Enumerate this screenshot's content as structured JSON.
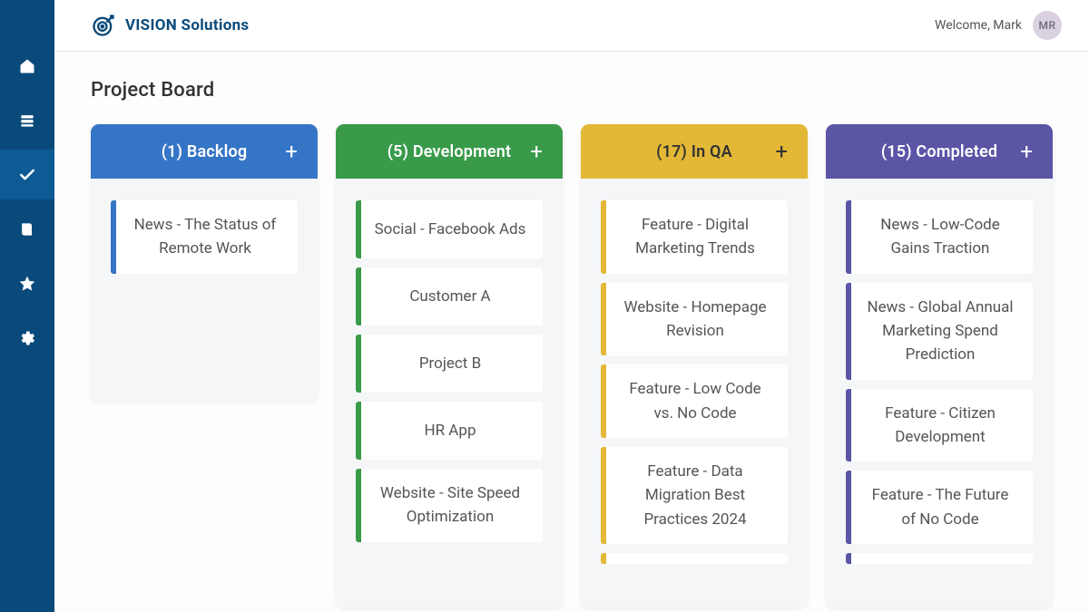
{
  "brand": "VISION Solutions",
  "welcome": "Welcome, Mark",
  "avatar_initials": "MR",
  "page_title": "Project Board",
  "sidebar": {
    "items": [
      {
        "icon": "home"
      },
      {
        "icon": "layers"
      },
      {
        "icon": "check",
        "active": true
      },
      {
        "icon": "book"
      },
      {
        "icon": "star"
      },
      {
        "icon": "gear"
      }
    ]
  },
  "board": {
    "add_label": "+",
    "columns": [
      {
        "count": 1,
        "label": "Backlog",
        "title_display": "(1) Backlog",
        "short": true,
        "cards": [
          "News - The Status of Remote Work"
        ]
      },
      {
        "count": 5,
        "label": "Development",
        "title_display": "(5) Development",
        "short": false,
        "cards": [
          "Social - Facebook Ads",
          "Customer A",
          "Project B",
          "HR App",
          "Website - Site Speed Optimization"
        ]
      },
      {
        "count": 17,
        "label": "In QA",
        "title_display": "(17) In QA",
        "short": false,
        "cards": [
          "Feature - Digital Marketing Trends",
          "Website - Homepage Revision",
          "Feature - Low Code vs. No Code",
          "Feature - Data Migration Best Practices 2024"
        ]
      },
      {
        "count": 15,
        "label": "Completed",
        "title_display": "(15) Completed",
        "short": false,
        "cards": [
          "News - Low-Code Gains Traction",
          "News - Global Annual Marketing Spend Prediction",
          "Feature - Citizen Development",
          "Feature - The Future of No Code"
        ]
      }
    ]
  }
}
